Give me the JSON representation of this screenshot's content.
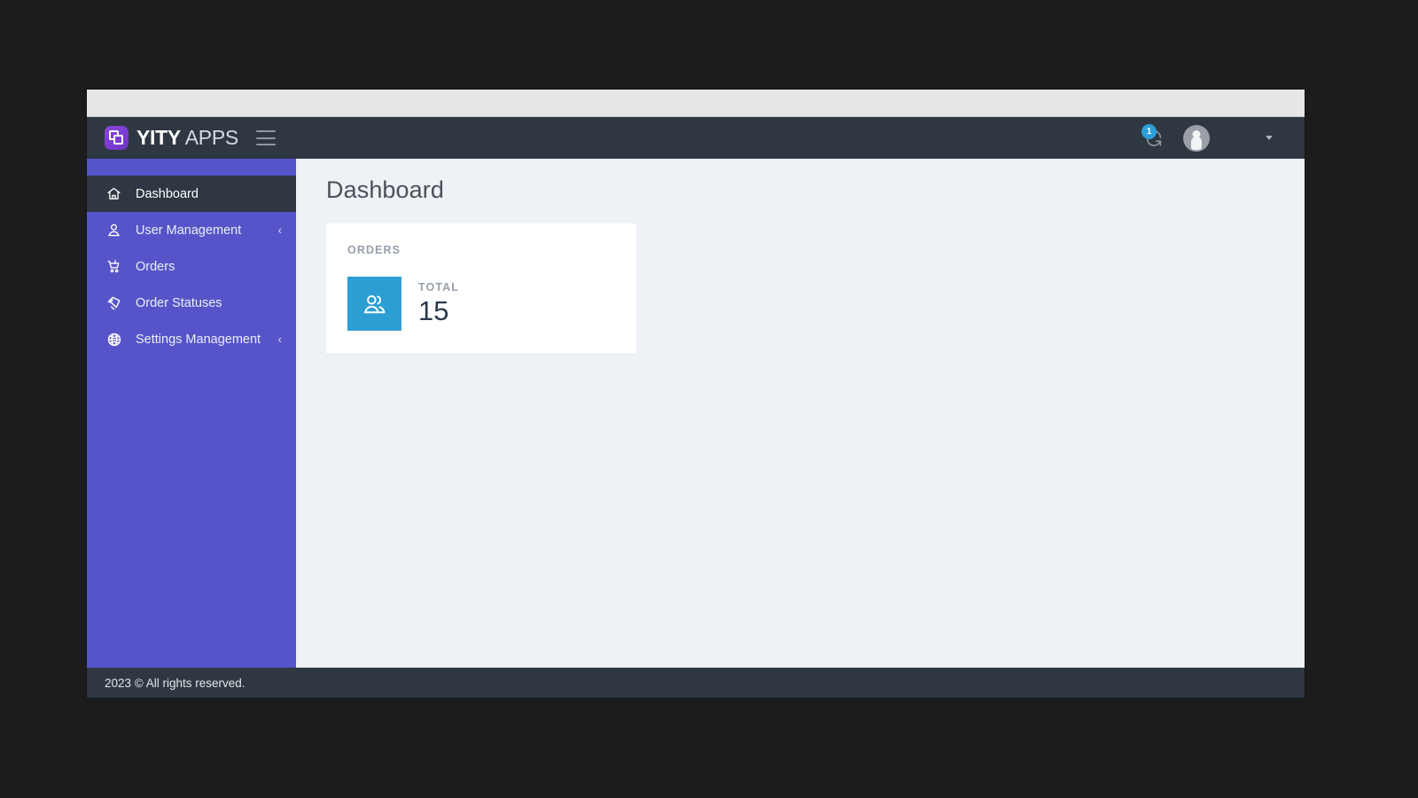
{
  "window": {
    "browser_chrome_color": "#e6e6e6"
  },
  "topbar": {
    "brand_bold": "YITY",
    "brand_light": " APPS",
    "logo_icon": "overlapping-squares-icon",
    "menu_icon": "hamburger-menu-icon",
    "notification": {
      "icon": "sync-refresh-icon",
      "badge_count": "1",
      "badge_color": "#2b9fd9"
    },
    "user": {
      "avatar_icon": "user-avatar-icon",
      "name": "",
      "caret_icon": "chevron-down-icon"
    },
    "background_color": "#2e3742"
  },
  "sidebar": {
    "background_color": "#5754c9",
    "active_background_color": "#2e3742",
    "items": [
      {
        "label": "Dashboard",
        "icon": "home-icon",
        "active": true,
        "expandable": false,
        "arrow": ""
      },
      {
        "label": "User Management",
        "icon": "user-icon",
        "active": false,
        "expandable": true,
        "arrow": "‹"
      },
      {
        "label": "Orders",
        "icon": "cart-icon",
        "active": false,
        "expandable": false,
        "arrow": ""
      },
      {
        "label": "Order Statuses",
        "icon": "tag-icon",
        "active": false,
        "expandable": false,
        "arrow": ""
      },
      {
        "label": "Settings Management",
        "icon": "globe-gear-icon",
        "active": false,
        "expandable": true,
        "arrow": "‹"
      }
    ]
  },
  "main": {
    "page_title": "Dashboard",
    "background_color": "#eef1f5",
    "cards": [
      {
        "title": "ORDERS",
        "tile_icon": "users-group-icon",
        "tile_color": "#2d9ed3",
        "stat_label": "TOTAL",
        "stat_value": "15"
      }
    ]
  },
  "footer": {
    "text": "2023 © All rights reserved.",
    "background_color": "#2e3742"
  }
}
